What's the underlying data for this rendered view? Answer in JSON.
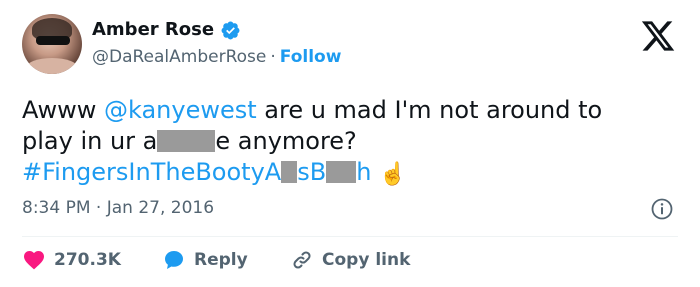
{
  "author": {
    "name": "Amber Rose",
    "handle": "@DaRealAmberRose",
    "separator": "·",
    "follow_label": "Follow"
  },
  "tweet": {
    "line1_prefix": "Awww ",
    "mention": "@kanyewest",
    "line1_suffix": " are u mad I'm not around to",
    "line2_prefix": "play in ur a",
    "line2_suffix": "e anymore?",
    "hashtag_part1": "#FingersInTheBootyA",
    "hashtag_part2": "sB",
    "hashtag_part3": "h",
    "emoji": "☝️"
  },
  "meta": {
    "time": "8:34 PM",
    "separator": " · ",
    "date": "Jan 27, 2016"
  },
  "actions": {
    "likes": "270.3K",
    "reply_label": "Reply",
    "copy_label": "Copy link"
  },
  "colors": {
    "accent": "#1d9bf0",
    "like": "#f91880",
    "text": "#0f1419",
    "muted": "#536471"
  },
  "icons": {
    "verified": "verified-badge-icon",
    "logo": "x-logo-icon",
    "info": "info-icon",
    "like": "heart-icon",
    "reply": "reply-bubble-icon",
    "copy": "link-icon"
  }
}
